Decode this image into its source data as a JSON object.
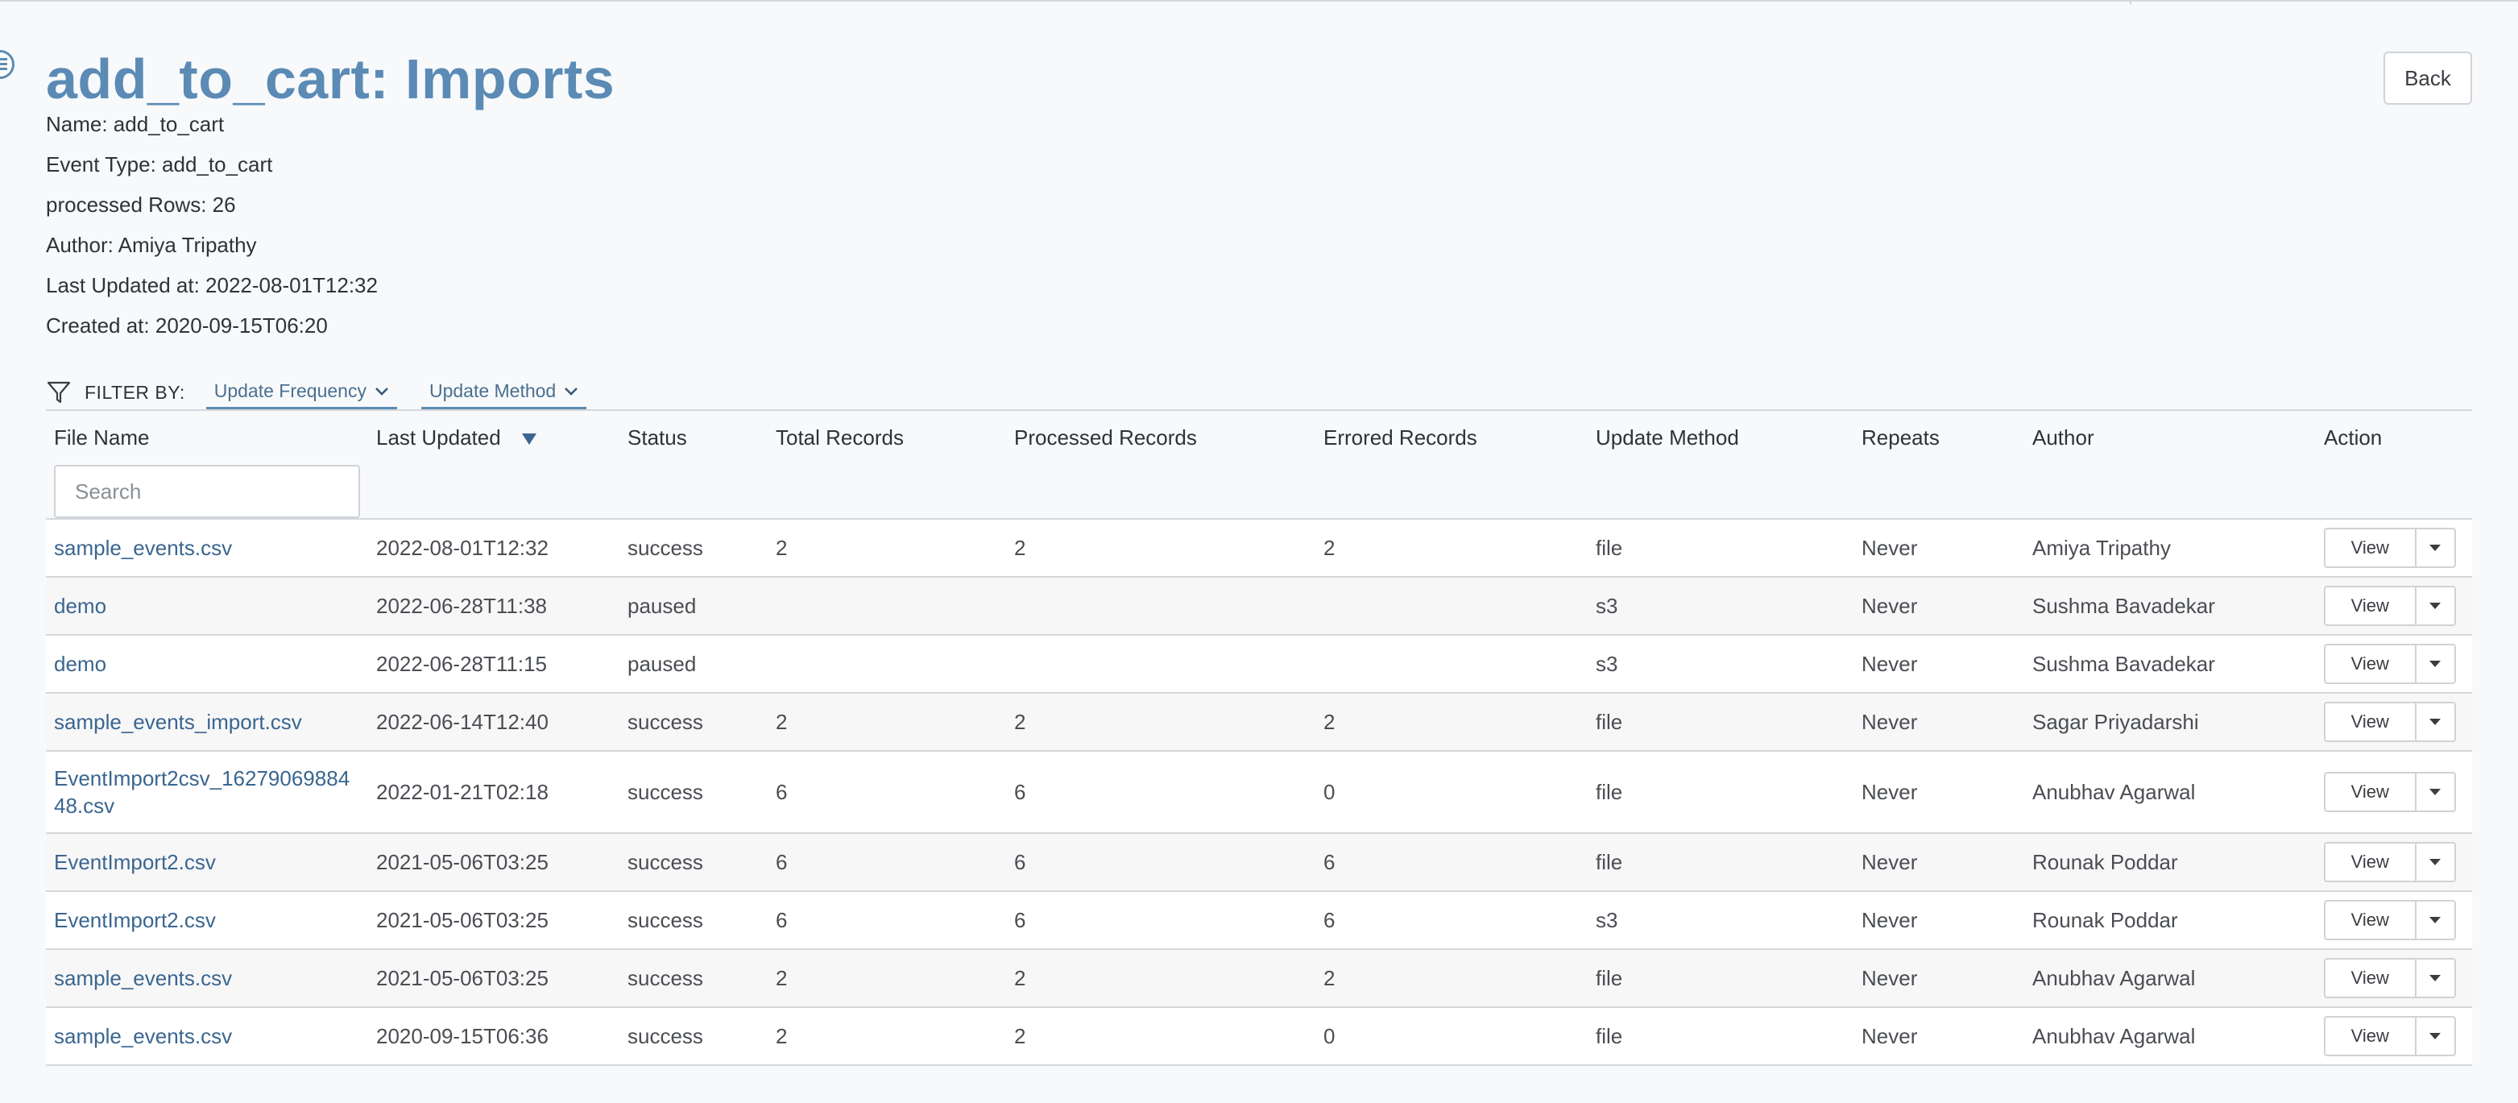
{
  "page": {
    "title": "add_to_cart: Imports",
    "back_label": "Back"
  },
  "meta": {
    "name": "Name: add_to_cart",
    "event_type": "Event Type: add_to_cart",
    "processed_rows": "processed Rows: 26",
    "author": "Author: Amiya Tripathy",
    "last_updated": "Last Updated at: 2022-08-01T12:32",
    "created": "Created at: 2020-09-15T06:20"
  },
  "filters": {
    "label": "FILTER BY:",
    "update_frequency": "Update Frequency",
    "update_method": "Update Method"
  },
  "table": {
    "headers": {
      "file_name": "File Name",
      "last_updated": "Last Updated",
      "status": "Status",
      "total_records": "Total Records",
      "processed_records": "Processed Records",
      "errored_records": "Errored Records",
      "update_method": "Update Method",
      "repeats": "Repeats",
      "author": "Author",
      "action": "Action"
    },
    "search_placeholder": "Search",
    "view_label": "View",
    "rows": [
      {
        "file": "sample_events.csv",
        "updated": "2022-08-01T12:32",
        "status": "success",
        "total": "2",
        "processed": "2",
        "errored": "2",
        "method": "file",
        "repeats": "Never",
        "author": "Amiya Tripathy"
      },
      {
        "file": "demo",
        "updated": "2022-06-28T11:38",
        "status": "paused",
        "total": "",
        "processed": "",
        "errored": "",
        "method": "s3",
        "repeats": "Never",
        "author": "Sushma Bavadekar"
      },
      {
        "file": "demo",
        "updated": "2022-06-28T11:15",
        "status": "paused",
        "total": "",
        "processed": "",
        "errored": "",
        "method": "s3",
        "repeats": "Never",
        "author": "Sushma Bavadekar"
      },
      {
        "file": "sample_events_import.csv",
        "updated": "2022-06-14T12:40",
        "status": "success",
        "total": "2",
        "processed": "2",
        "errored": "2",
        "method": "file",
        "repeats": "Never",
        "author": "Sagar Priyadarshi"
      },
      {
        "file": "EventImport2csv_1627906988448.csv",
        "updated": "2022-01-21T02:18",
        "status": "success",
        "total": "6",
        "processed": "6",
        "errored": "0",
        "method": "file",
        "repeats": "Never",
        "author": "Anubhav Agarwal"
      },
      {
        "file": "EventImport2.csv",
        "updated": "2021-05-06T03:25",
        "status": "success",
        "total": "6",
        "processed": "6",
        "errored": "6",
        "method": "file",
        "repeats": "Never",
        "author": "Rounak Poddar"
      },
      {
        "file": "EventImport2.csv",
        "updated": "2021-05-06T03:25",
        "status": "success",
        "total": "6",
        "processed": "6",
        "errored": "6",
        "method": "s3",
        "repeats": "Never",
        "author": "Rounak Poddar"
      },
      {
        "file": "sample_events.csv",
        "updated": "2021-05-06T03:25",
        "status": "success",
        "total": "2",
        "processed": "2",
        "errored": "2",
        "method": "file",
        "repeats": "Never",
        "author": "Anubhav Agarwal"
      },
      {
        "file": "sample_events.csv",
        "updated": "2020-09-15T06:36",
        "status": "success",
        "total": "2",
        "processed": "2",
        "errored": "0",
        "method": "file",
        "repeats": "Never",
        "author": "Anubhav Agarwal"
      }
    ]
  },
  "icons": {
    "filter": "filter-funnel-icon",
    "sort": "sort-descending-icon",
    "dropdown": "chevron-down-icon",
    "menu": "menu-icon"
  },
  "colors": {
    "title": "#5b8bb5",
    "link": "#3a6690",
    "filter_underline": "#5b8bb5"
  }
}
